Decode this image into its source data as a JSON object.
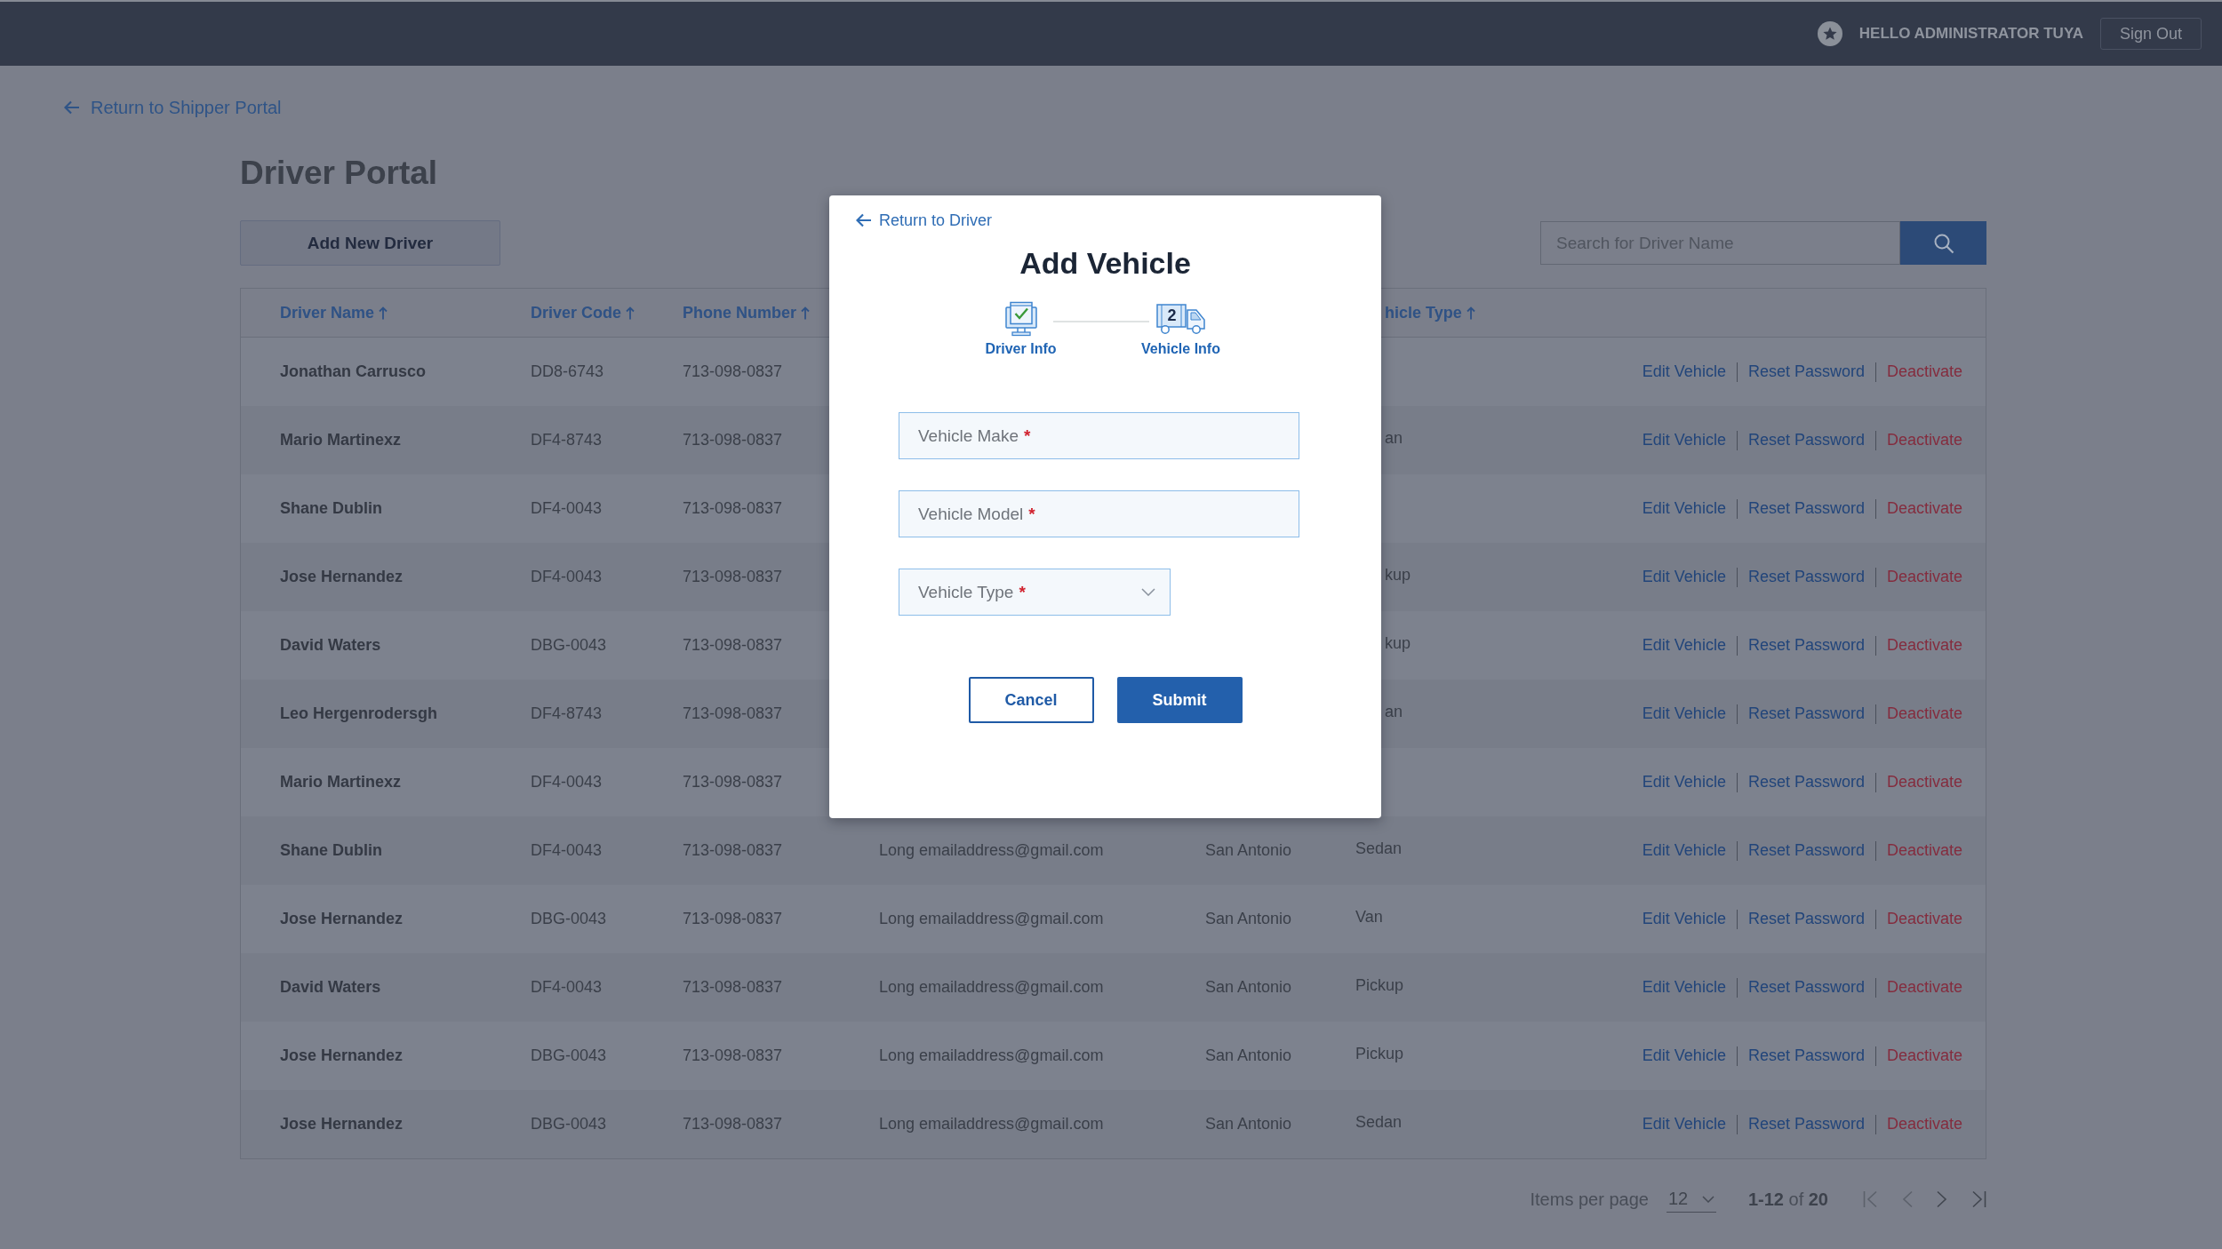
{
  "top_bar": {
    "greeting": "HELLO ADMINISTRATOR TUYA",
    "sign_out": "Sign Out"
  },
  "back_link": "Return to Shipper Portal",
  "page_title": "Driver Portal",
  "toolbar": {
    "add_button": "Add New Driver",
    "search": {
      "placeholder": "Search for Driver Name"
    }
  },
  "table": {
    "columns": [
      {
        "kind": "name",
        "label": "Driver Name",
        "sorted_ascending": true
      },
      {
        "kind": "code",
        "label": "Driver Code",
        "sorted_ascending": true
      },
      {
        "kind": "phone",
        "label": "Phone Number",
        "sorted_ascending": true
      },
      {
        "kind": "vehicle",
        "label": "hicle Type",
        "sorted_ascending": true
      }
    ],
    "rows": [
      {
        "name": "Jonathan Carrusco",
        "code": "DD8-6743",
        "phone": "713-098-0837",
        "actions": [
          {
            "label": "Edit Vehicle",
            "kind": "link"
          },
          {
            "label": "Reset Password",
            "kind": "link"
          },
          {
            "label": "Deactivate",
            "kind": "danger"
          }
        ]
      },
      {
        "name": "Mario Martinexz",
        "code": "DF4-8743",
        "phone": "713-098-0837",
        "vehicle_type": "an",
        "actions": [
          {
            "label": "Edit Vehicle",
            "kind": "link"
          },
          {
            "label": "Reset Password",
            "kind": "link"
          },
          {
            "label": "Deactivate",
            "kind": "danger"
          }
        ]
      },
      {
        "name": "Shane Dublin",
        "code": "DF4-0043",
        "phone": "713-098-0837",
        "actions": [
          {
            "label": "Edit Vehicle",
            "kind": "link"
          },
          {
            "label": "Reset Password",
            "kind": "link"
          },
          {
            "label": "Deactivate",
            "kind": "danger"
          }
        ]
      },
      {
        "name": "Jose Hernandez",
        "code": "DF4-0043",
        "phone": "713-098-0837",
        "vehicle_type": "kup",
        "actions": [
          {
            "label": "Edit Vehicle",
            "kind": "link"
          },
          {
            "label": "Reset Password",
            "kind": "link"
          },
          {
            "label": "Deactivate",
            "kind": "danger"
          }
        ]
      },
      {
        "name": "David Waters",
        "code": "DBG-0043",
        "phone": "713-098-0837",
        "vehicle_type": "kup",
        "actions": [
          {
            "label": "Edit Vehicle",
            "kind": "link"
          },
          {
            "label": "Reset Password",
            "kind": "link"
          },
          {
            "label": "Deactivate",
            "kind": "danger"
          }
        ]
      },
      {
        "name": "Leo Hergenrodersgh",
        "code": "DF4-8743",
        "phone": "713-098-0837",
        "vehicle_type": "an",
        "actions": [
          {
            "label": "Edit Vehicle",
            "kind": "link"
          },
          {
            "label": "Reset Password",
            "kind": "link"
          },
          {
            "label": "Deactivate",
            "kind": "danger"
          }
        ]
      },
      {
        "name": "Mario Martinexz",
        "code": "DF4-0043",
        "phone": "713-098-0837",
        "actions": [
          {
            "label": "Edit Vehicle",
            "kind": "link"
          },
          {
            "label": "Reset Password",
            "kind": "link"
          },
          {
            "label": "Deactivate",
            "kind": "danger"
          }
        ]
      },
      {
        "name": "Shane Dublin",
        "code": "DF4-0043",
        "phone": "713-098-0837",
        "email": "Long emailaddress@gmail.com",
        "city": "San Antonio",
        "vehicle_type": "Sedan",
        "actions": [
          {
            "label": "Edit Vehicle",
            "kind": "link"
          },
          {
            "label": "Reset Password",
            "kind": "link"
          },
          {
            "label": "Deactivate",
            "kind": "danger"
          }
        ]
      },
      {
        "name": "Jose Hernandez",
        "code": "DBG-0043",
        "phone": "713-098-0837",
        "email": "Long emailaddress@gmail.com",
        "city": "San Antonio",
        "vehicle_type": "Van",
        "actions": [
          {
            "label": "Edit Vehicle",
            "kind": "link"
          },
          {
            "label": "Reset Password",
            "kind": "link"
          },
          {
            "label": "Deactivate",
            "kind": "danger"
          }
        ]
      },
      {
        "name": "David Waters",
        "code": "DF4-0043",
        "phone": "713-098-0837",
        "email": "Long emailaddress@gmail.com",
        "city": "San Antonio",
        "vehicle_type": "Pickup",
        "actions": [
          {
            "label": "Edit Vehicle",
            "kind": "link"
          },
          {
            "label": "Reset Password",
            "kind": "link"
          },
          {
            "label": "Deactivate",
            "kind": "danger"
          }
        ]
      },
      {
        "name": "Jose Hernandez",
        "code": "DBG-0043",
        "phone": "713-098-0837",
        "email": "Long emailaddress@gmail.com",
        "city": "San Antonio",
        "vehicle_type": "Pickup",
        "actions": [
          {
            "label": "Edit Vehicle",
            "kind": "link"
          },
          {
            "label": "Reset Password",
            "kind": "link"
          },
          {
            "label": "Deactivate",
            "kind": "danger"
          }
        ]
      },
      {
        "name": "Jose Hernandez",
        "code": "DBG-0043",
        "phone": "713-098-0837",
        "email": "Long emailaddress@gmail.com",
        "city": "San Antonio",
        "vehicle_type": "Sedan",
        "actions": [
          {
            "label": "Edit Vehicle",
            "kind": "link"
          },
          {
            "label": "Reset Password",
            "kind": "link"
          },
          {
            "label": "Deactivate",
            "kind": "danger"
          }
        ]
      }
    ]
  },
  "pagination": {
    "items_per_page_label": "Items per page",
    "page_size": "12",
    "range": "**1-12** of **20**",
    "buttons": [
      {
        "kind": "first",
        "disabled": true
      },
      {
        "kind": "prev",
        "disabled": true
      },
      {
        "kind": "next",
        "disabled": false
      },
      {
        "kind": "last",
        "disabled": false
      }
    ]
  },
  "modal": {
    "back_link": "Return to Driver",
    "title": "Add Vehicle",
    "steps": [
      {
        "kind": "driver",
        "label": "Driver Info",
        "completed": true
      },
      {
        "kind": "vehicle",
        "label": "Vehicle Info",
        "number": "2",
        "completed": false
      }
    ],
    "fields": [
      {
        "kind": "text",
        "placeholder": "Vehicle Make",
        "required_mark": "*"
      },
      {
        "kind": "text",
        "placeholder": "Vehicle Model",
        "required_mark": "*"
      },
      {
        "kind": "select",
        "placeholder": "Vehicle Type",
        "required_mark": "*"
      }
    ],
    "buttons": [
      {
        "label": "Cancel",
        "kind": "secondary"
      },
      {
        "label": "Submit",
        "kind": "primary"
      }
    ]
  }
}
